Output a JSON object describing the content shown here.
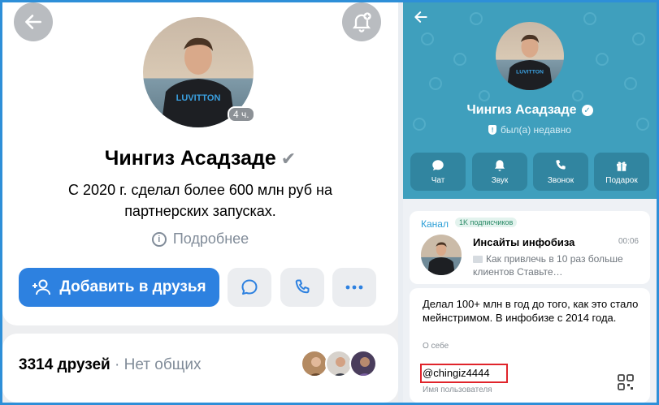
{
  "vk": {
    "back_icon": "arrow-left-icon",
    "bell_icon": "bell-plus-icon",
    "online_badge": "4 ч.",
    "name": "Чингиз Асадзаде",
    "verified_icon": "checkmark-icon",
    "status": "С 2020 г. сделал более 600 млн руб на партнерских запусках.",
    "more_label": "Подробнее",
    "add_friend_label": "Добавить в друзья",
    "friends_count": "3314 друзей",
    "friends_mutual": "· Нет общих",
    "accent": "#2d81e0"
  },
  "telegram": {
    "name": "Чингиз Асадзаде",
    "last_seen": "был(а) недавно",
    "actions": [
      {
        "label": "Чат",
        "icon": "chat-icon"
      },
      {
        "label": "Звук",
        "icon": "bell-icon"
      },
      {
        "label": "Звонок",
        "icon": "phone-icon"
      },
      {
        "label": "Подарок",
        "icon": "gift-icon"
      }
    ],
    "channel": {
      "label": "Канал",
      "subscribers": "1K подписчиков",
      "title": "Инсайты инфобиза",
      "time": "00:06",
      "preview": "Как привлечь в 10 раз больше клиентов  Ставьте…"
    },
    "bio": {
      "text": "Делал 100+ млн в год до того, как это стало мейнстримом. В инфобизе с 2014 года.",
      "label": "О себе"
    },
    "username": {
      "value": "@chingiz4444",
      "label": "Имя пользователя"
    },
    "header_color": "#3f9fbd",
    "highlight_color": "#e0242b"
  }
}
